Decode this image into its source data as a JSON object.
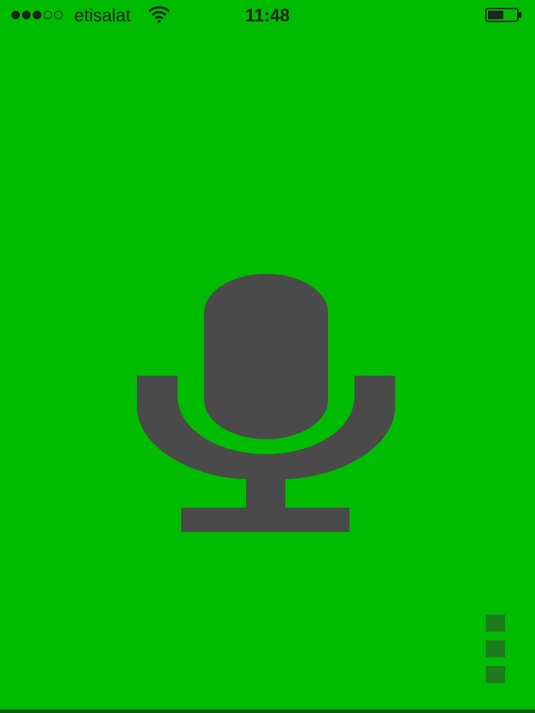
{
  "status_bar": {
    "signal_bars": {
      "filled": 3,
      "total": 5
    },
    "carrier": "etisalat",
    "wifi_icon": "wifi-icon",
    "time": "11:48",
    "battery_icon": "battery-icon",
    "battery_level": 0.55
  },
  "main": {
    "icon": "microphone-icon",
    "icon_color": "#4A4A4A",
    "background_color": "#00BC00"
  },
  "page_indicator": {
    "count": 3,
    "color": "#1E7A1E"
  }
}
